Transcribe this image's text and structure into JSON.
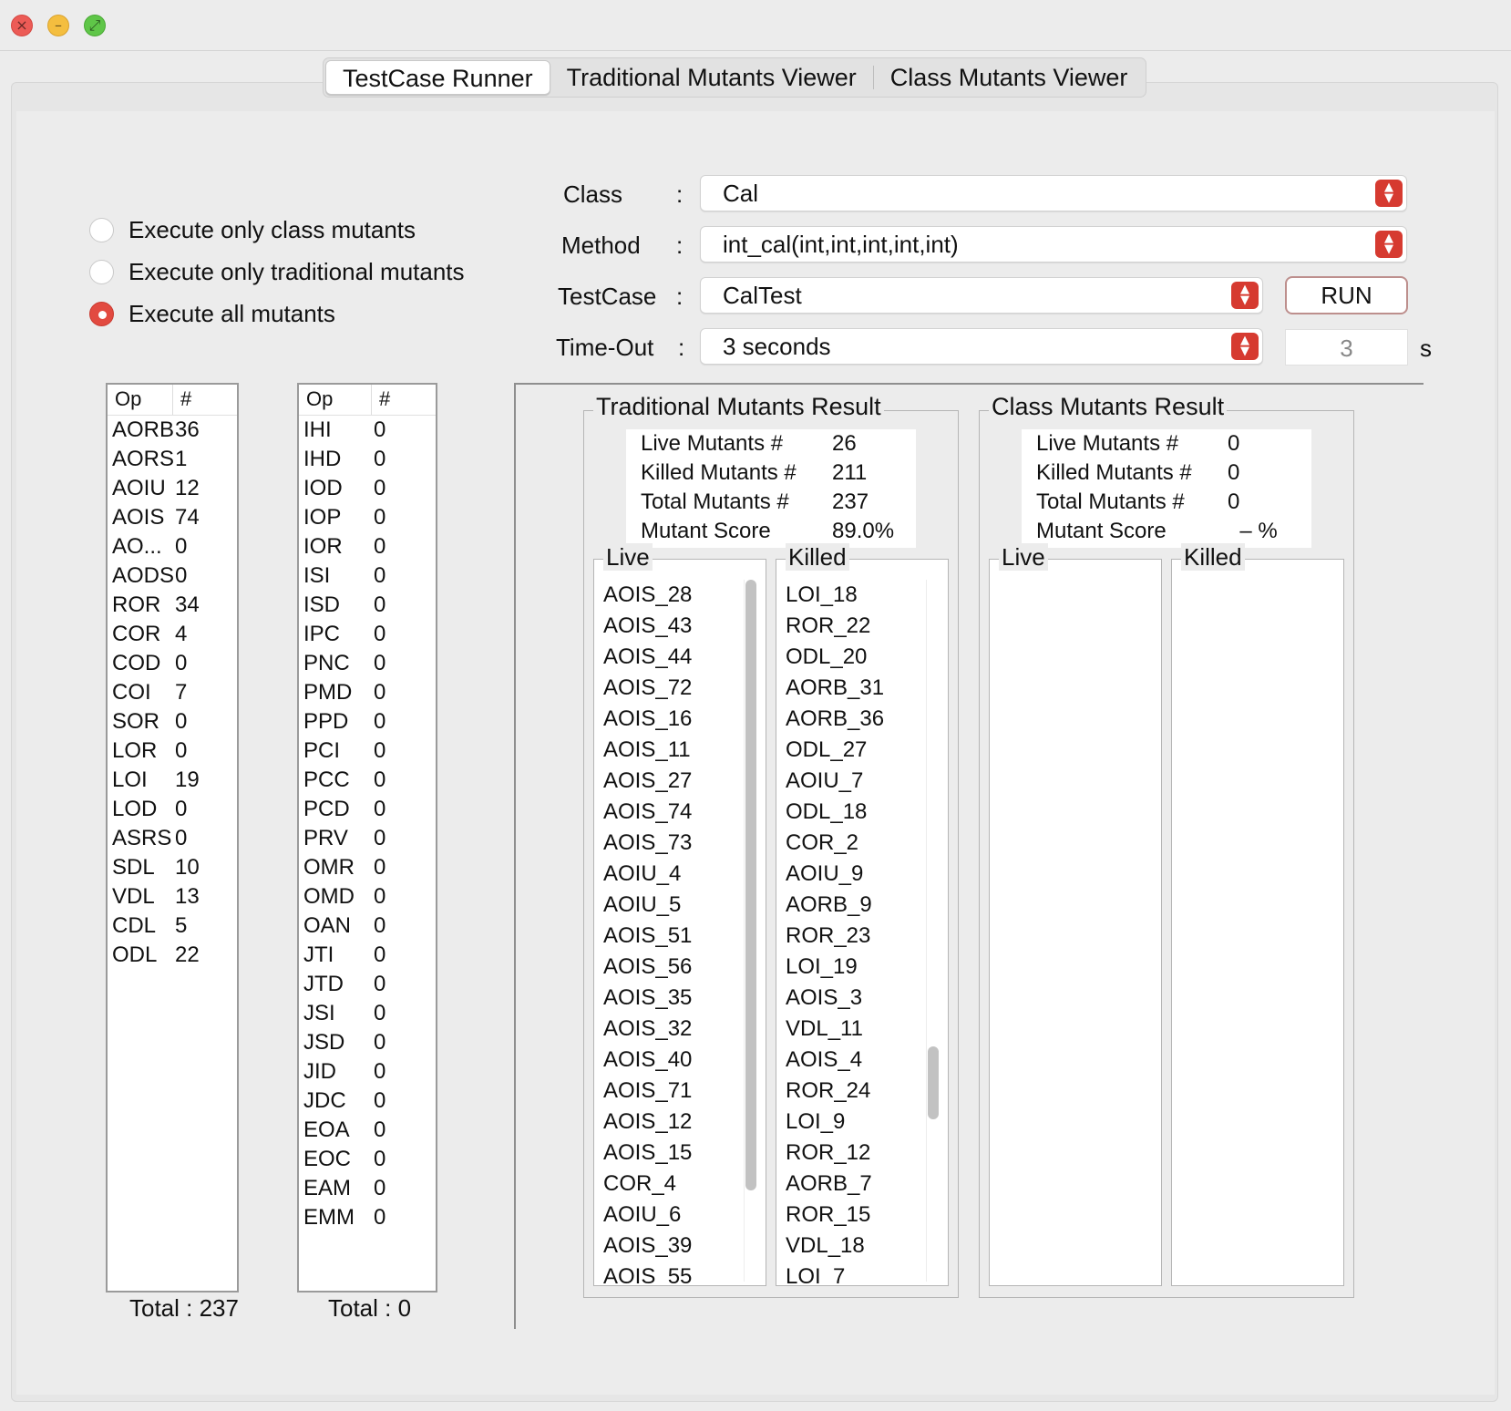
{
  "window": {
    "controls": [
      "close-icon",
      "minimize-icon",
      "maximize-icon"
    ]
  },
  "tabs": [
    {
      "label": "TestCase Runner",
      "active": true
    },
    {
      "label": "Traditional Mutants Viewer",
      "active": false
    },
    {
      "label": "Class Mutants Viewer",
      "active": false
    }
  ],
  "options": {
    "radios": [
      {
        "label": "Execute only class mutants",
        "selected": false
      },
      {
        "label": "Execute only traditional mutants",
        "selected": false
      },
      {
        "label": "Execute all mutants",
        "selected": true
      }
    ]
  },
  "form": {
    "class_label": "Class",
    "method_label": "Method",
    "testcase_label": "TestCase",
    "timeout_label": "Time-Out",
    "colon": ":",
    "class_value": "Cal",
    "method_value": "int_cal(int,int,int,int,int)",
    "testcase_value": "CalTest",
    "timeout_value": "3 seconds",
    "run_label": "RUN",
    "timeout_seconds": "3",
    "timeout_unit": "s"
  },
  "traditional_ops": {
    "header": [
      "Op",
      "#"
    ],
    "rows": [
      [
        "AORB",
        "36"
      ],
      [
        "AORS",
        "1"
      ],
      [
        "AOIU",
        "12"
      ],
      [
        "AOIS",
        "74"
      ],
      [
        "AO...",
        "0"
      ],
      [
        "AODS",
        "0"
      ],
      [
        "ROR",
        "34"
      ],
      [
        "COR",
        "4"
      ],
      [
        "COD",
        "0"
      ],
      [
        "COI",
        "7"
      ],
      [
        "SOR",
        "0"
      ],
      [
        "LOR",
        "0"
      ],
      [
        "LOI",
        "19"
      ],
      [
        "LOD",
        "0"
      ],
      [
        "ASRS",
        "0"
      ],
      [
        "SDL",
        "10"
      ],
      [
        "VDL",
        "13"
      ],
      [
        "CDL",
        "5"
      ],
      [
        "ODL",
        "22"
      ]
    ],
    "total": "Total : 237"
  },
  "class_ops": {
    "header": [
      "Op",
      "#"
    ],
    "rows": [
      [
        "IHI",
        "0"
      ],
      [
        "IHD",
        "0"
      ],
      [
        "IOD",
        "0"
      ],
      [
        "IOP",
        "0"
      ],
      [
        "IOR",
        "0"
      ],
      [
        "ISI",
        "0"
      ],
      [
        "ISD",
        "0"
      ],
      [
        "IPC",
        "0"
      ],
      [
        "PNC",
        "0"
      ],
      [
        "PMD",
        "0"
      ],
      [
        "PPD",
        "0"
      ],
      [
        "PCI",
        "0"
      ],
      [
        "PCC",
        "0"
      ],
      [
        "PCD",
        "0"
      ],
      [
        "PRV",
        "0"
      ],
      [
        "OMR",
        "0"
      ],
      [
        "OMD",
        "0"
      ],
      [
        "OAN",
        "0"
      ],
      [
        "JTI",
        "0"
      ],
      [
        "JTD",
        "0"
      ],
      [
        "JSI",
        "0"
      ],
      [
        "JSD",
        "0"
      ],
      [
        "JID",
        "0"
      ],
      [
        "JDC",
        "0"
      ],
      [
        "EOA",
        "0"
      ],
      [
        "EOC",
        "0"
      ],
      [
        "EAM",
        "0"
      ],
      [
        "EMM",
        "0"
      ]
    ],
    "total": "Total : 0"
  },
  "traditional_result": {
    "title": "Traditional Mutants Result",
    "stats": [
      [
        "Live Mutants #",
        "26"
      ],
      [
        "Killed Mutants #",
        "211"
      ],
      [
        "Total Mutants #",
        "237"
      ],
      [
        "Mutant Score",
        "89.0%"
      ]
    ],
    "live_title": "Live",
    "killed_title": "Killed",
    "live": [
      "AOIS_28",
      "AOIS_43",
      "AOIS_44",
      "AOIS_72",
      "AOIS_16",
      "AOIS_11",
      "AOIS_27",
      "AOIS_74",
      "AOIS_73",
      "AOIU_4",
      "AOIU_5",
      "AOIS_51",
      "AOIS_56",
      "AOIS_35",
      "AOIS_32",
      "AOIS_40",
      "AOIS_71",
      "AOIS_12",
      "AOIS_15",
      "COR_4",
      "AOIU_6",
      "AOIS_39",
      "AOIS_55"
    ],
    "killed": [
      "LOI_18",
      "ROR_22",
      "ODL_20",
      "AORB_31",
      "AORB_36",
      "ODL_27",
      "AOIU_7",
      "ODL_18",
      "COR_2",
      "AOIU_9",
      "AORB_9",
      "ROR_23",
      "LOI_19",
      "AOIS_3",
      "VDL_11",
      "AOIS_4",
      "ROR_24",
      "LOI_9",
      "ROR_12",
      "AORB_7",
      "ROR_15",
      "VDL_18",
      "LOI_7"
    ]
  },
  "class_result": {
    "title": "Class Mutants Result",
    "stats": [
      [
        "Live Mutants #",
        "0"
      ],
      [
        "Killed Mutants #",
        "0"
      ],
      [
        "Total Mutants #",
        "0"
      ],
      [
        "Mutant Score",
        "  – %"
      ]
    ],
    "live_title": "Live",
    "killed_title": "Killed"
  }
}
